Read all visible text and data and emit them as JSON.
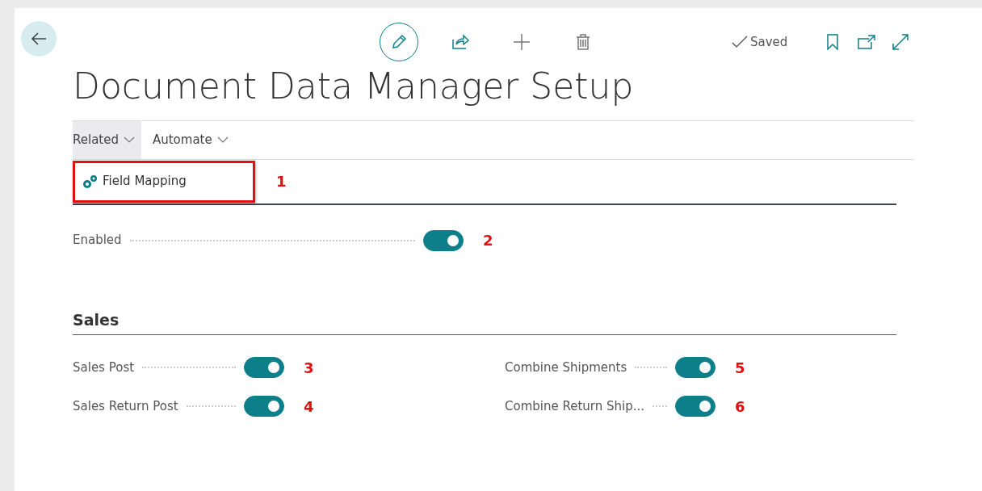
{
  "toolbar": [
    {
      "kind": "edit"
    },
    {
      "kind": "share"
    },
    {
      "kind": "new"
    },
    {
      "kind": "delete"
    }
  ],
  "status": "Saved",
  "title": "Document Data Manager Setup",
  "action_tabs": [
    {
      "label": "Related",
      "selected": true
    },
    {
      "label": "Automate",
      "selected": false
    }
  ],
  "actions": [
    {
      "label": "Field Mapping",
      "highlighted": true,
      "callout": "1"
    }
  ],
  "general_fields": [
    {
      "label": "Enabled",
      "on": true,
      "callout": "2"
    }
  ],
  "sales": {
    "title": "Sales",
    "columns": [
      [
        {
          "label": "Sales Post",
          "on": true,
          "callout": "3"
        },
        {
          "label": "Sales Return Post",
          "on": true,
          "callout": "4"
        }
      ],
      [
        {
          "label": "Combine Shipments",
          "on": true,
          "callout": "5"
        },
        {
          "label": "Combine Return Ship...",
          "on": true,
          "callout": "6"
        }
      ]
    ]
  }
}
